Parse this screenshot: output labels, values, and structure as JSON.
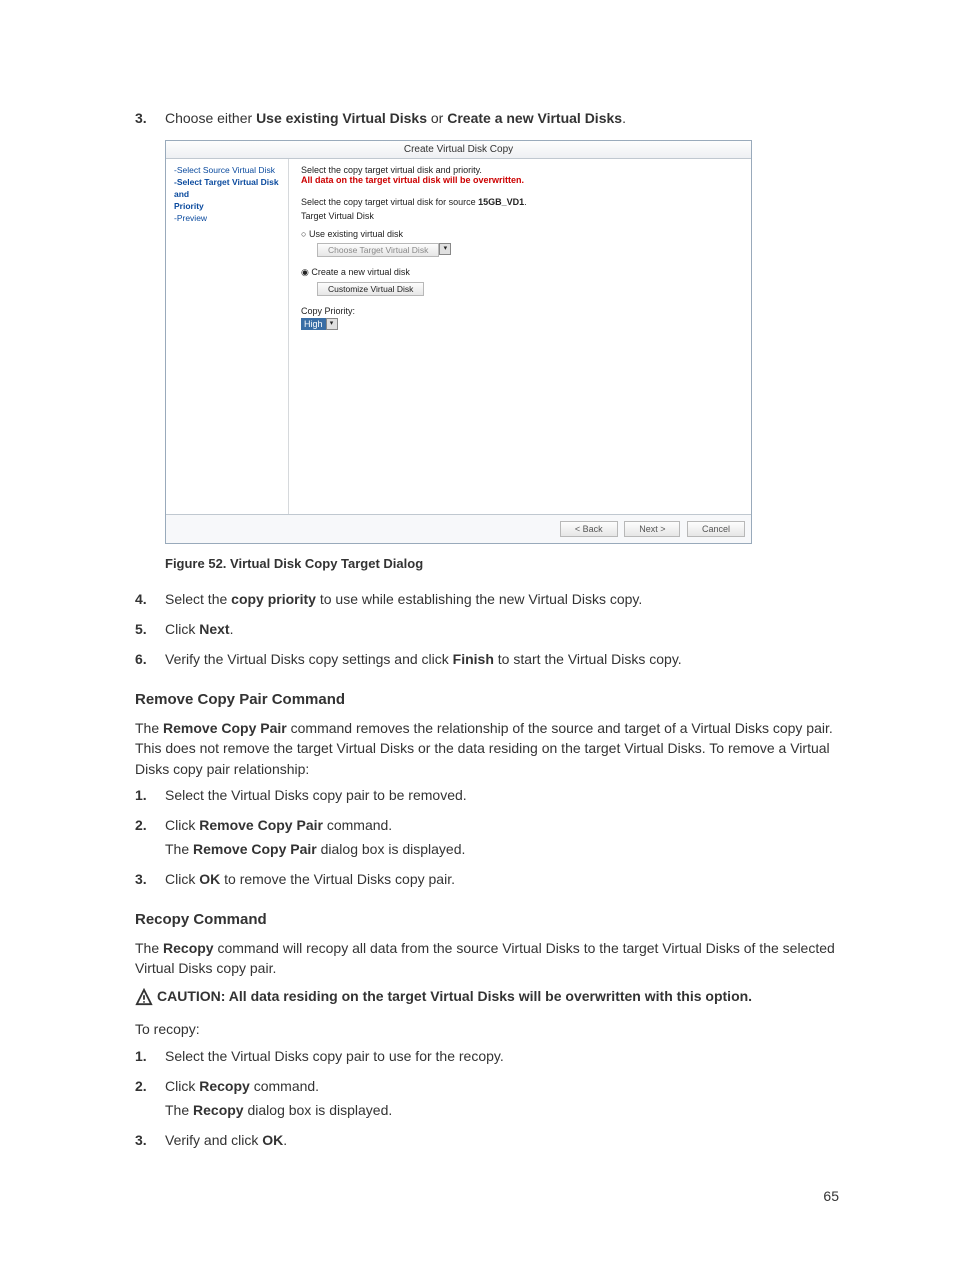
{
  "step3": {
    "num": "3.",
    "pre": "Choose either ",
    "b1": "Use existing Virtual Disks",
    "mid": " or ",
    "b2": "Create a new Virtual Disks",
    "post": "."
  },
  "dialog": {
    "title": "Create Virtual Disk Copy",
    "left": {
      "l1": "-Select Source Virtual Disk",
      "l2a": "-Select Target Virtual Disk and",
      "l2b": "Priority",
      "l3": "-Preview"
    },
    "right": {
      "line1": "Select the copy target virtual disk and priority.",
      "line2": "All data on the target virtual disk will be overwritten.",
      "line3a": "Select the copy target virtual disk for source ",
      "line3b": "15GB_VD1",
      "line3c": ".",
      "tvd": "Target Virtual Disk",
      "opt1": "Use existing virtual disk",
      "chooseBtn": "Choose Target Virtual Disk",
      "opt2": "Create a new virtual disk",
      "custBtn": "Customize Virtual Disk",
      "cpLabel": "Copy Priority:",
      "cpVal": "High"
    },
    "footer": {
      "back": "< Back",
      "next": "Next >",
      "cancel": "Cancel"
    }
  },
  "figCaption": "Figure 52. Virtual Disk Copy Target Dialog",
  "step4": {
    "num": "4.",
    "pre": "Select the ",
    "b": "copy priority",
    "post": " to use while establishing the new Virtual Disks copy."
  },
  "step5": {
    "num": "5.",
    "pre": "Click ",
    "b": "Next",
    "post": "."
  },
  "step6": {
    "num": "6.",
    "pre": "Verify the Virtual Disks copy settings and click ",
    "b": "Finish",
    "post": " to start the Virtual Disks copy."
  },
  "sec1": {
    "h": "Remove Copy Pair Command",
    "p_a": "The ",
    "p_b": "Remove Copy Pair",
    "p_c": " command removes the relationship of the source and target of a Virtual Disks copy pair. This does not remove the target Virtual Disks or the data residing on the target Virtual Disks. To remove a Virtual Disks copy pair relationship:",
    "s1": {
      "num": "1.",
      "t": "Select the Virtual Disks copy pair to be removed."
    },
    "s2": {
      "num": "2.",
      "pre": "Click ",
      "b": "Remove Copy Pair",
      "post": " command.",
      "l2a": "The ",
      "l2b": "Remove Copy Pair",
      "l2c": " dialog box is displayed."
    },
    "s3": {
      "num": "3.",
      "pre": "Click ",
      "b": "OK",
      "post": " to remove the Virtual Disks copy pair."
    }
  },
  "sec2": {
    "h": "Recopy Command",
    "p_a": "The ",
    "p_b": "Recopy",
    "p_c": " command will recopy all data from the source Virtual Disks to the target Virtual Disks of the selected Virtual Disks copy pair.",
    "caution": "CAUTION: All data residing on the target Virtual Disks will be overwritten with this option.",
    "toRecopy": "To recopy:",
    "s1": {
      "num": "1.",
      "t": "Select the Virtual Disks copy pair to use for the recopy."
    },
    "s2": {
      "num": "2.",
      "pre": "Click ",
      "b": "Recopy",
      "post": " command.",
      "l2a": "The ",
      "l2b": "Recopy",
      "l2c": " dialog box is displayed."
    },
    "s3": {
      "num": "3.",
      "pre": "Verify and click ",
      "b": "OK",
      "post": "."
    }
  },
  "pageNum": "65"
}
